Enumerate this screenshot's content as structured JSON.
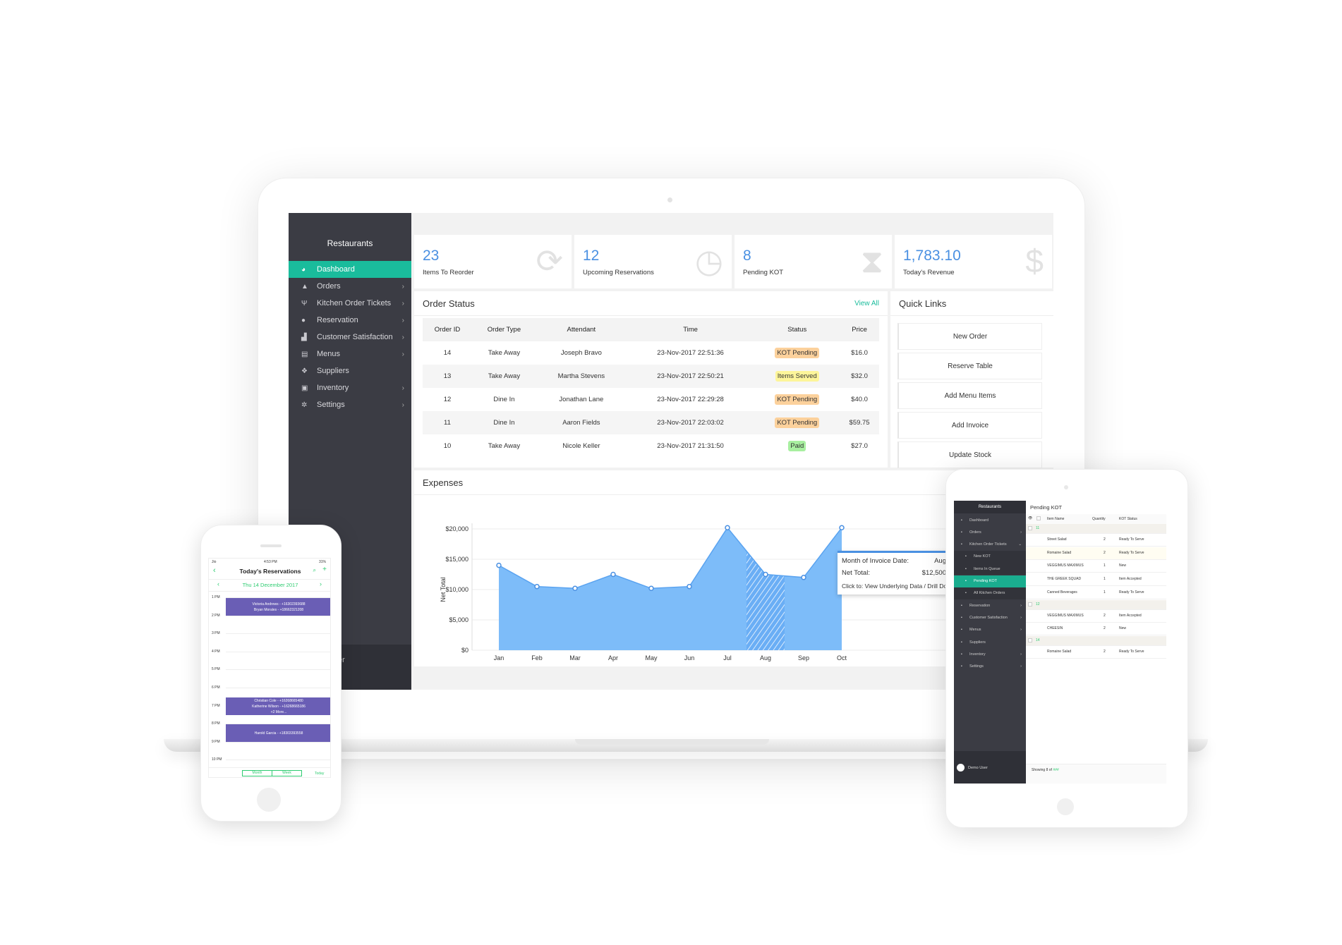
{
  "laptop": {
    "sidebar": {
      "title": "Restaurants",
      "items": [
        {
          "label": "Dashboard",
          "icon": "dashboard-icon",
          "active": true,
          "chevron": false
        },
        {
          "label": "Orders",
          "icon": "orders-icon",
          "chevron": true
        },
        {
          "label": "Kitchen Order Tickets",
          "icon": "utensils-icon",
          "chevron": true
        },
        {
          "label": "Reservation",
          "icon": "reservation-icon",
          "chevron": true
        },
        {
          "label": "Customer Satisfaction",
          "icon": "satisfaction-icon",
          "chevron": true
        },
        {
          "label": "Menus",
          "icon": "menu-book-icon",
          "chevron": true
        },
        {
          "label": "Suppliers",
          "icon": "suppliers-icon",
          "chevron": false
        },
        {
          "label": "Inventory",
          "icon": "inventory-icon",
          "chevron": true
        },
        {
          "label": "Settings",
          "icon": "gear-icon",
          "chevron": true
        }
      ],
      "footer_user": "er"
    },
    "stats": [
      {
        "value": "23",
        "label": "Items To Reorder",
        "icon": "refresh-icon"
      },
      {
        "value": "12",
        "label": "Upcoming Reservations",
        "icon": "clock-icon"
      },
      {
        "value": "8",
        "label": "Pending KOT",
        "icon": "hourglass-icon"
      },
      {
        "value": "1,783.10",
        "label": "Today's Revenue",
        "icon": "dollar-icon"
      }
    ],
    "order_status": {
      "title": "Order Status",
      "view_all": "View All",
      "columns": [
        "Order ID",
        "Order Type",
        "Attendant",
        "Time",
        "Status",
        "Price"
      ],
      "rows": [
        {
          "id": "14",
          "type": "Take Away",
          "attendant": "Joseph Bravo",
          "time": "23-Nov-2017 22:51:36",
          "status": "KOT Pending",
          "price": "$16.0"
        },
        {
          "id": "13",
          "type": "Take Away",
          "attendant": "Martha Stevens",
          "time": "23-Nov-2017 22:50:21",
          "status": "Items Served",
          "price": "$32.0"
        },
        {
          "id": "12",
          "type": "Dine In",
          "attendant": "Jonathan Lane",
          "time": "23-Nov-2017 22:29:28",
          "status": "KOT Pending",
          "price": "$40.0"
        },
        {
          "id": "11",
          "type": "Dine In",
          "attendant": "Aaron Fields",
          "time": "23-Nov-2017 22:03:02",
          "status": "KOT Pending",
          "price": "$59.75"
        },
        {
          "id": "10",
          "type": "Take Away",
          "attendant": "Nicole Keller",
          "time": "23-Nov-2017 21:31:50",
          "status": "Paid",
          "price": "$27.0"
        }
      ],
      "status_colors": {
        "KOT Pending": "#fcd19c",
        "Items Served": "#fdf59a",
        "Paid": "#a8efa0"
      }
    },
    "quick_links": {
      "title": "Quick Links",
      "items": [
        "New Order",
        "Reserve Table",
        "Add Menu Items",
        "Add Invoice",
        "Update Stock"
      ]
    },
    "expenses": {
      "title": "Expenses",
      "tooltip": {
        "label1": "Month of Invoice Date:",
        "value1": "Aug",
        "label2": "Net Total:",
        "value2": "$12,500",
        "hint": "Click to: View Underlying Data / Drill Dow"
      }
    }
  },
  "chart_data": {
    "type": "area",
    "title": "Expenses",
    "xlabel": "",
    "ylabel": "Net Total",
    "categories": [
      "Jan",
      "Feb",
      "Mar",
      "Apr",
      "May",
      "Jun",
      "Jul",
      "Aug",
      "Sep",
      "Oct"
    ],
    "values": [
      14000,
      10500,
      10200,
      12500,
      10200,
      10500,
      20200,
      12500,
      12000,
      20200
    ],
    "ylim": [
      0,
      20000
    ],
    "yticks": [
      "$0",
      "$5,000",
      "$10,000",
      "$15,000",
      "$20,000"
    ],
    "ytick_values": [
      0,
      5000,
      10000,
      15000,
      20000
    ],
    "highlighted": "Aug",
    "grid": true,
    "color": "#7dbcf9"
  },
  "phone": {
    "status": {
      "carrier": "Jio",
      "time": "4:53 PM",
      "battery": "31%"
    },
    "title": "Today's Reservations",
    "date": "Thu 14 December 2017",
    "hours": [
      "1 PM",
      "2 PM",
      "3 PM",
      "4 PM",
      "5 PM",
      "6 PM",
      "7 PM",
      "8 PM",
      "9 PM",
      "10 PM"
    ],
    "blocks": [
      {
        "lines": [
          "Victoria Andrews - +16302393688",
          "Bryan Morales - +18662321208"
        ]
      },
      {
        "lines": [
          "Christian Cole - +16268665480",
          "Katherine Wilson - +16268665186",
          "+2 More..."
        ]
      },
      {
        "lines": [
          "Harold Garcia - +18303393558"
        ]
      }
    ],
    "tabs": [
      "Month",
      "Week"
    ],
    "today": "Today",
    "accent": "#2ecc71"
  },
  "tablet": {
    "sidebar": {
      "title": "Restaurants",
      "items": [
        {
          "label": "Dashboard",
          "chev": ""
        },
        {
          "label": "Orders",
          "chev": "›"
        },
        {
          "label": "Kitchen Order Tickets",
          "chev": "⌄"
        },
        {
          "label": "New KOT",
          "sub": true
        },
        {
          "label": "Items In Queue",
          "sub": true
        },
        {
          "label": "Pending KOT",
          "sub": true,
          "active": true
        },
        {
          "label": "All Kitchen Orders",
          "sub": true
        },
        {
          "label": "Reservation",
          "chev": "›"
        },
        {
          "label": "Customer Satisfaction",
          "chev": "›"
        },
        {
          "label": "Menus",
          "chev": "›"
        },
        {
          "label": "Suppliers",
          "chev": ""
        },
        {
          "label": "Inventory",
          "chev": "›"
        },
        {
          "label": "Settings",
          "chev": "›"
        }
      ],
      "user": "Demo User"
    },
    "title": "Pending KOT",
    "columns": [
      "Item Name",
      "Quantity",
      "KOT Status"
    ],
    "rows": [
      {
        "group": "11"
      },
      {
        "item": "Street Salad",
        "qty": "2",
        "status": "Ready To Serve"
      },
      {
        "item": "Romaine Salad",
        "qty": "2",
        "status": "Ready To Serve",
        "highlight": true
      },
      {
        "item": "VEGGIMUS MAXIMUS",
        "qty": "1",
        "status": "New"
      },
      {
        "item": "THE GREEK SQUAD",
        "qty": "1",
        "status": "Item Accepted"
      },
      {
        "item": "Canned Beverages",
        "qty": "1",
        "status": "Ready To Serve"
      },
      {
        "group": "12"
      },
      {
        "item": "VEGGIMUS MAXIMUS",
        "qty": "2",
        "status": "Item Accepted"
      },
      {
        "item": "CHEESIN",
        "qty": "2",
        "status": "New"
      },
      {
        "group": "14"
      },
      {
        "item": "Romaine Salad",
        "qty": "2",
        "status": "Ready To Serve"
      }
    ],
    "footer": "Showing 8 of",
    "footer_count": "###"
  }
}
